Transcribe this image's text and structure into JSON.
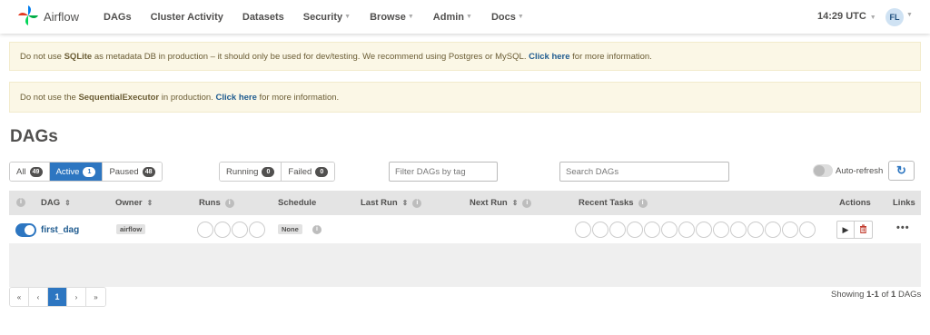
{
  "navbar": {
    "brand": "Airflow",
    "items": [
      {
        "label": "DAGs",
        "caret": false
      },
      {
        "label": "Cluster Activity",
        "caret": false
      },
      {
        "label": "Datasets",
        "caret": false
      },
      {
        "label": "Security",
        "caret": true
      },
      {
        "label": "Browse",
        "caret": true
      },
      {
        "label": "Admin",
        "caret": true
      },
      {
        "label": "Docs",
        "caret": true
      }
    ],
    "clock": "14:29 UTC",
    "user_initials": "FL"
  },
  "alerts": [
    {
      "pre": "Do not use ",
      "bold": "SQLite",
      "mid": " as metadata DB in production – it should only be used for dev/testing. We recommend using Postgres or MySQL. ",
      "link": "Click here",
      "post": " for more information."
    },
    {
      "pre": "Do not use the ",
      "bold": "SequentialExecutor",
      "mid": " in production. ",
      "link": "Click here",
      "post": " for more information."
    }
  ],
  "page_title": "DAGs",
  "filters": {
    "status": [
      {
        "label": "All",
        "count": "49",
        "active": false
      },
      {
        "label": "Active",
        "count": "1",
        "active": true
      },
      {
        "label": "Paused",
        "count": "48",
        "active": false
      }
    ],
    "state": [
      {
        "label": "Running",
        "count": "0"
      },
      {
        "label": "Failed",
        "count": "0"
      }
    ],
    "tag_placeholder": "Filter DAGs by tag",
    "search_placeholder": "Search DAGs",
    "auto_refresh_label": "Auto-refresh"
  },
  "table": {
    "headers": {
      "dag": "DAG",
      "owner": "Owner",
      "runs": "Runs",
      "schedule": "Schedule",
      "last_run": "Last Run",
      "next_run": "Next Run",
      "recent_tasks": "Recent Tasks",
      "actions": "Actions",
      "links": "Links"
    },
    "rows": [
      {
        "paused": false,
        "dag_id": "first_dag",
        "owner": "airflow",
        "schedule": "None",
        "last_run": "",
        "next_run": "",
        "links": "•••"
      }
    ]
  },
  "pagination": {
    "first": "«",
    "prev": "‹",
    "current": "1",
    "next": "›",
    "last": "»",
    "showing_pre": "Showing ",
    "showing_range": "1-1",
    "showing_mid": " of ",
    "showing_total": "1",
    "showing_post": " DAGs"
  },
  "colors": {
    "accent": "#2d76c1",
    "alert_bg": "#fbf7e6",
    "header_bg": "#e4e4e4",
    "delete": "#c0392b"
  }
}
